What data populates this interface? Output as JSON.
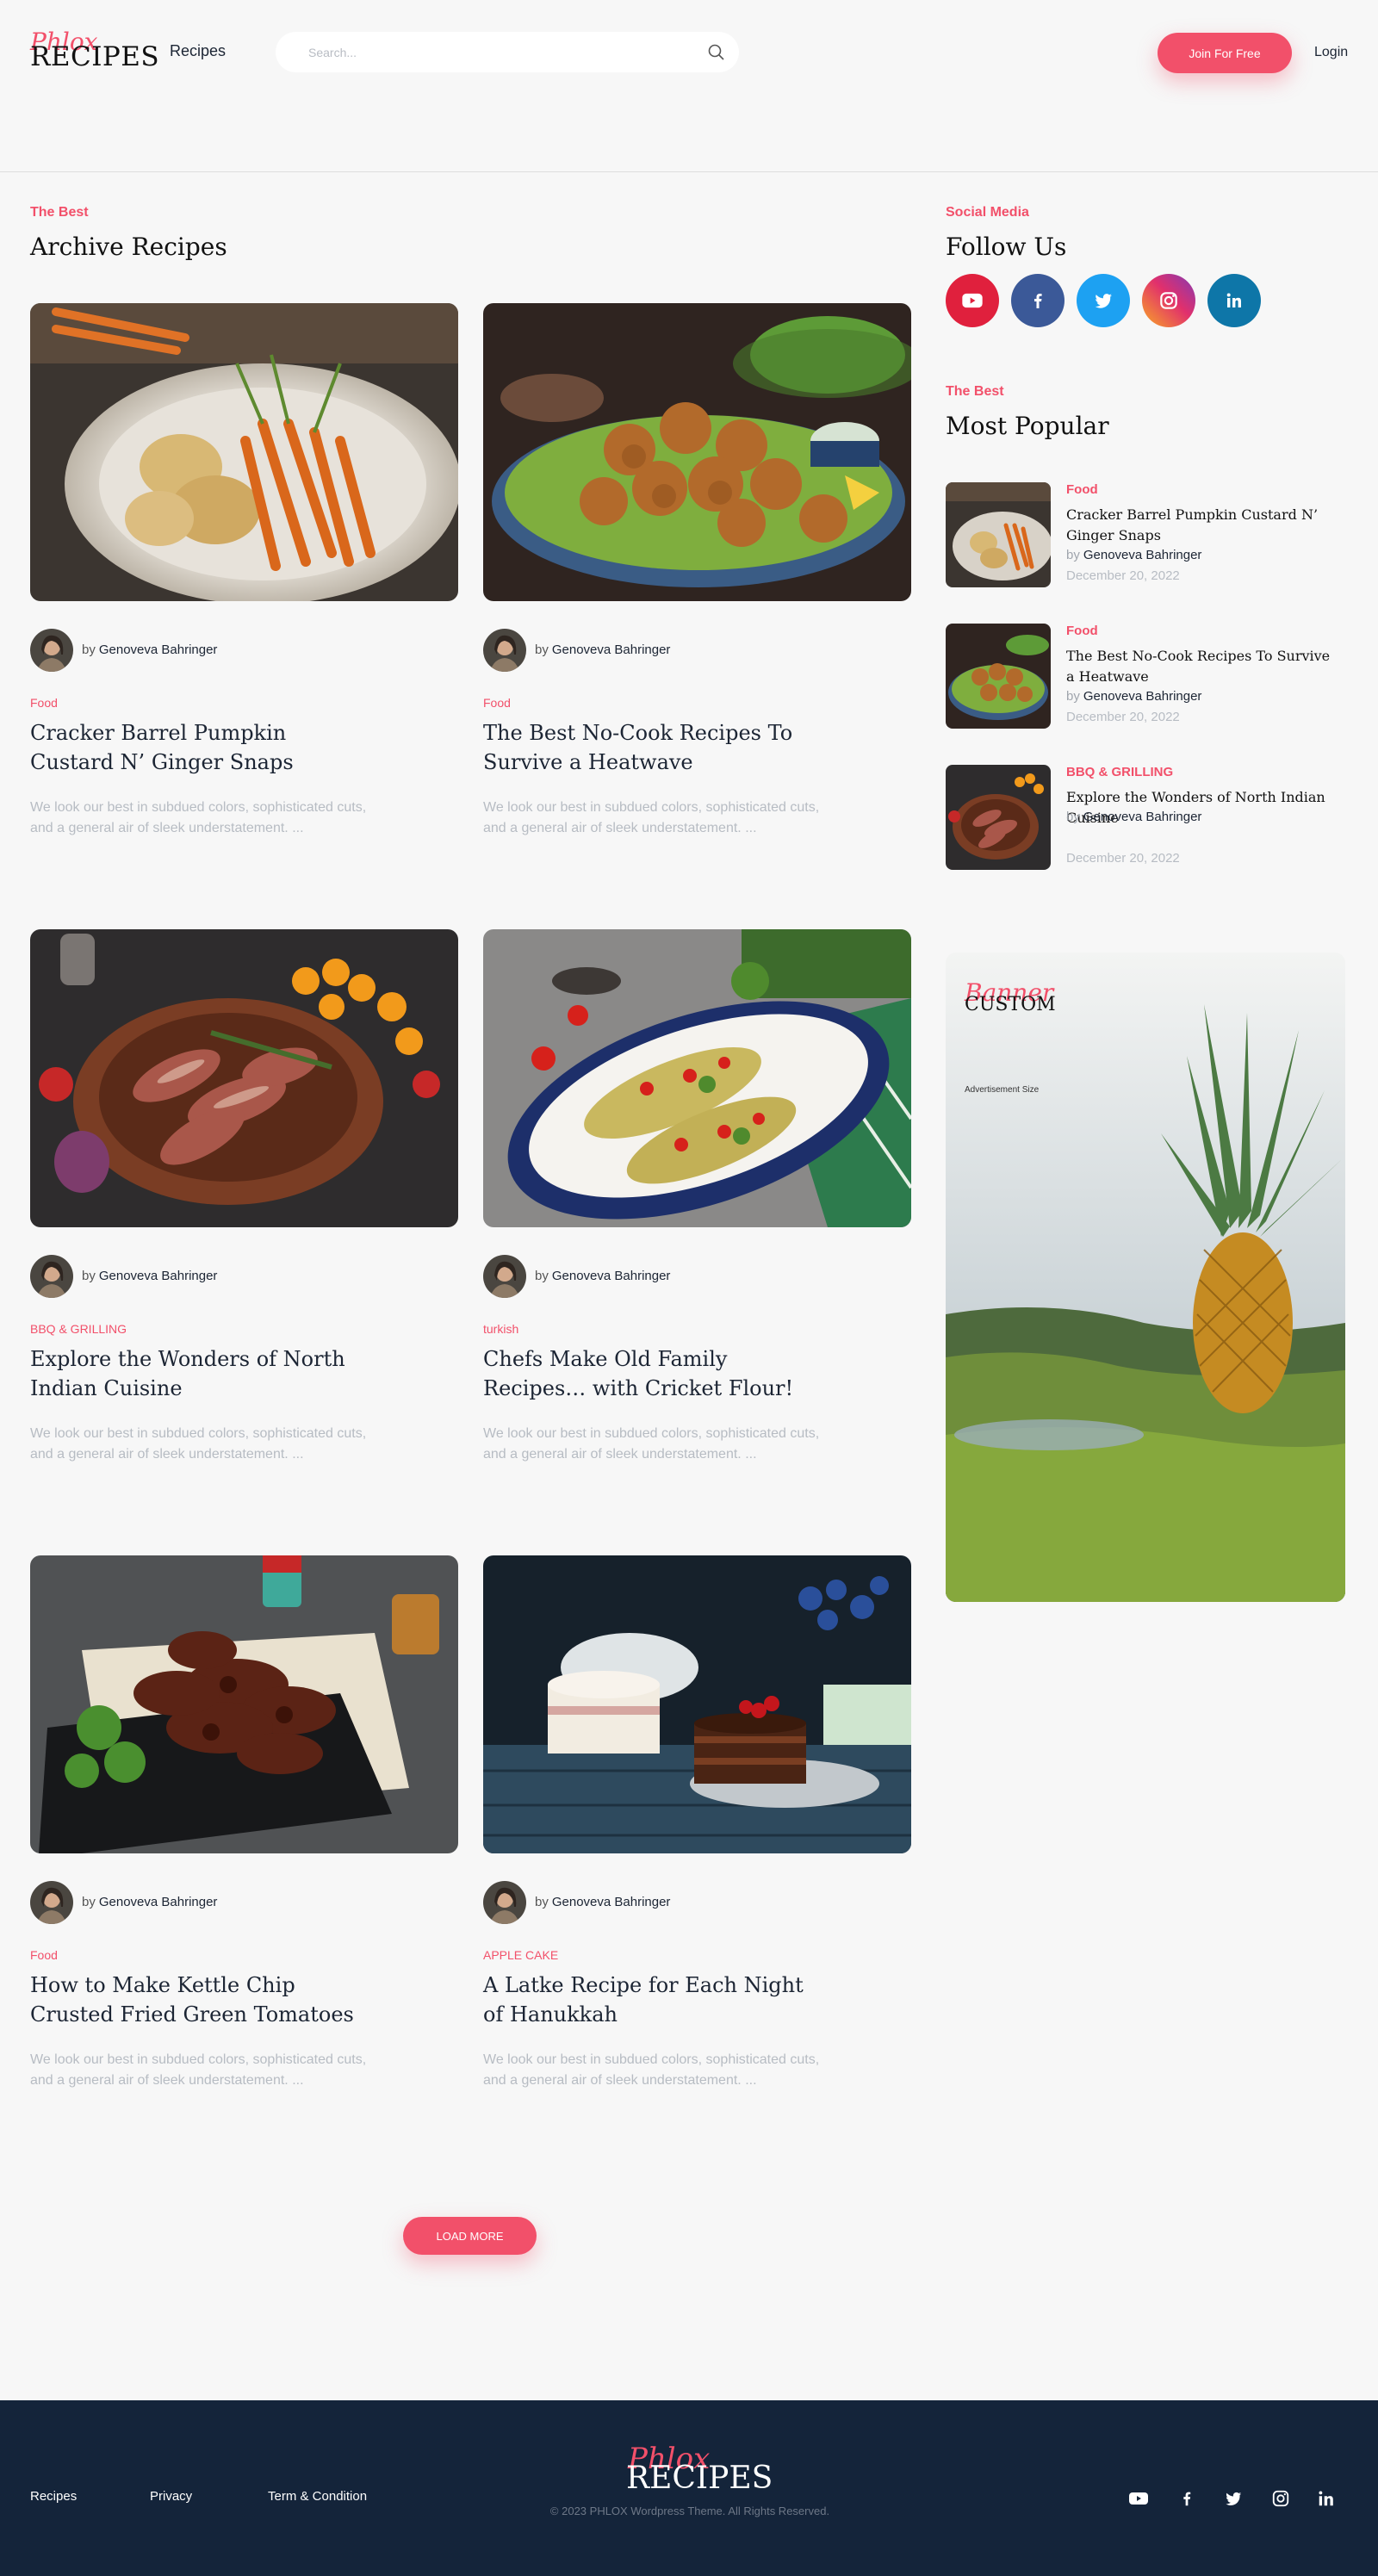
{
  "header": {
    "logo_script": "Phlox",
    "logo_main": "RECIPES",
    "nav_recipes": "Recipes",
    "search_placeholder": "Search...",
    "join_label": "Join For Free",
    "login_label": "Login"
  },
  "archive": {
    "eyebrow": "The Best",
    "title": "Archive Recipes",
    "load_more": "LOAD MORE",
    "cards": [
      {
        "by": "by",
        "author": "Genoveva Bahringer",
        "category": "Food",
        "title": "Cracker Barrel Pumpkin Custard N’ Ginger Snaps",
        "excerpt": "We look our best in subdued colors, sophisticated cuts, and a general air of sleek understatement. ..."
      },
      {
        "by": "by",
        "author": "Genoveva Bahringer",
        "category": "Food",
        "title": "The Best No-Cook Recipes To Survive a Heatwave",
        "excerpt": "We look our best in subdued colors, sophisticated cuts, and a general air of sleek understatement. ..."
      },
      {
        "by": "by",
        "author": "Genoveva Bahringer",
        "category": "BBQ & GRILLING",
        "title": "Explore the Wonders of North Indian Cuisine",
        "excerpt": "We look our best in subdued colors, sophisticated cuts, and a general air of sleek understatement. ..."
      },
      {
        "by": "by",
        "author": "Genoveva Bahringer",
        "category": "turkish",
        "title": "Chefs Make Old Family Recipes… with Cricket Flour!",
        "excerpt": "We look our best in subdued colors, sophisticated cuts, and a general air of sleek understatement. ..."
      },
      {
        "by": "by",
        "author": "Genoveva Bahringer",
        "category": "Food",
        "title": "How to Make Kettle Chip Crusted Fried Green Tomatoes",
        "excerpt": "We look our best in subdued colors, sophisticated cuts, and a general air of sleek understatement. ..."
      },
      {
        "by": "by",
        "author": "Genoveva Bahringer",
        "category": "APPLE CAKE",
        "title": "A Latke Recipe for Each Night of Hanukkah",
        "excerpt": "We look our best in subdued colors, sophisticated cuts, and a general air of sleek understatement. ..."
      }
    ]
  },
  "sidebar": {
    "social_eyebrow": "Social Media",
    "social_title": "Follow Us",
    "social_icons": [
      "youtube-icon",
      "facebook-icon",
      "twitter-icon",
      "instagram-icon",
      "linkedin-icon"
    ],
    "popular_eyebrow": "The Best",
    "popular_title": "Most Popular",
    "popular": [
      {
        "category": "Food",
        "title": "Cracker Barrel Pumpkin Custard N’ Ginger Snaps",
        "by": "by",
        "author": "Genoveva Bahringer",
        "date": "December 20, 2022"
      },
      {
        "category": "Food",
        "title": "The Best No-Cook Recipes To Survive a Heatwave",
        "by": "by",
        "author": "Genoveva Bahringer",
        "date": "December 20, 2022"
      },
      {
        "category": "BBQ & GRILLING",
        "title": "Explore the Wonders of North Indian Cuisine",
        "by": "by",
        "author": "Genoveva Bahringer",
        "date": "December 20, 2022"
      }
    ],
    "banner": {
      "script": "Banner",
      "main": "CUSTOM",
      "size_label": "Advertisement Size"
    }
  },
  "footer": {
    "links": [
      "Recipes",
      "Privacy",
      "Term & Condition"
    ],
    "logo_script": "Phlox",
    "logo_main": "RECIPES",
    "copyright": "© 2023 PHLOX Wordpress Theme. All Rights Reserved."
  },
  "colors": {
    "accent": "#f2506a",
    "footer_bg": "#14243a",
    "page_bg": "#f7f7f7",
    "text": "#1c2534",
    "muted": "#b7bcc3"
  }
}
